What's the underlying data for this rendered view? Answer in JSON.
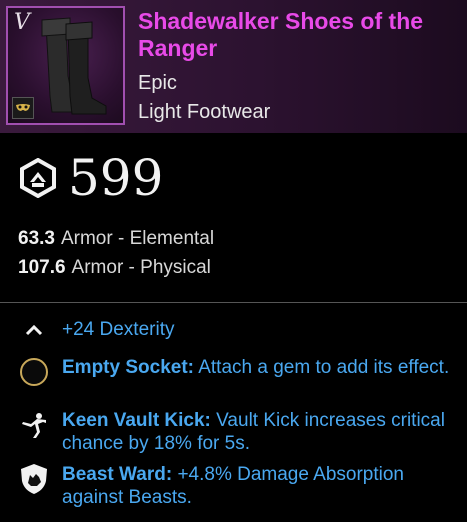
{
  "item": {
    "name": "Shadewalker Shoes of the Ranger",
    "rarity": "Epic",
    "type": "Light Footwear"
  },
  "gear_score": {
    "value": "599"
  },
  "armor": [
    {
      "value": "63.3",
      "label": "Armor - Elemental"
    },
    {
      "value": "107.6",
      "label": "Armor - Physical"
    }
  ],
  "attribute": {
    "text": "+24 Dexterity"
  },
  "perks": [
    {
      "name": "Empty Socket:",
      "desc": "Attach a gem to add its effect.",
      "icon": "empty-socket-icon"
    },
    {
      "name": "Keen Vault Kick:",
      "desc": "Vault Kick increases critical chance by 18% for 5s.",
      "icon": "vault-kick-icon"
    },
    {
      "name": "Beast Ward:",
      "desc": "+4.8% Damage Absorption against Beasts.",
      "icon": "beast-ward-icon"
    }
  ],
  "colors": {
    "title": "#e84ae8",
    "perk_text": "#4aa8f0",
    "header_bg": "#3a1a3d"
  }
}
